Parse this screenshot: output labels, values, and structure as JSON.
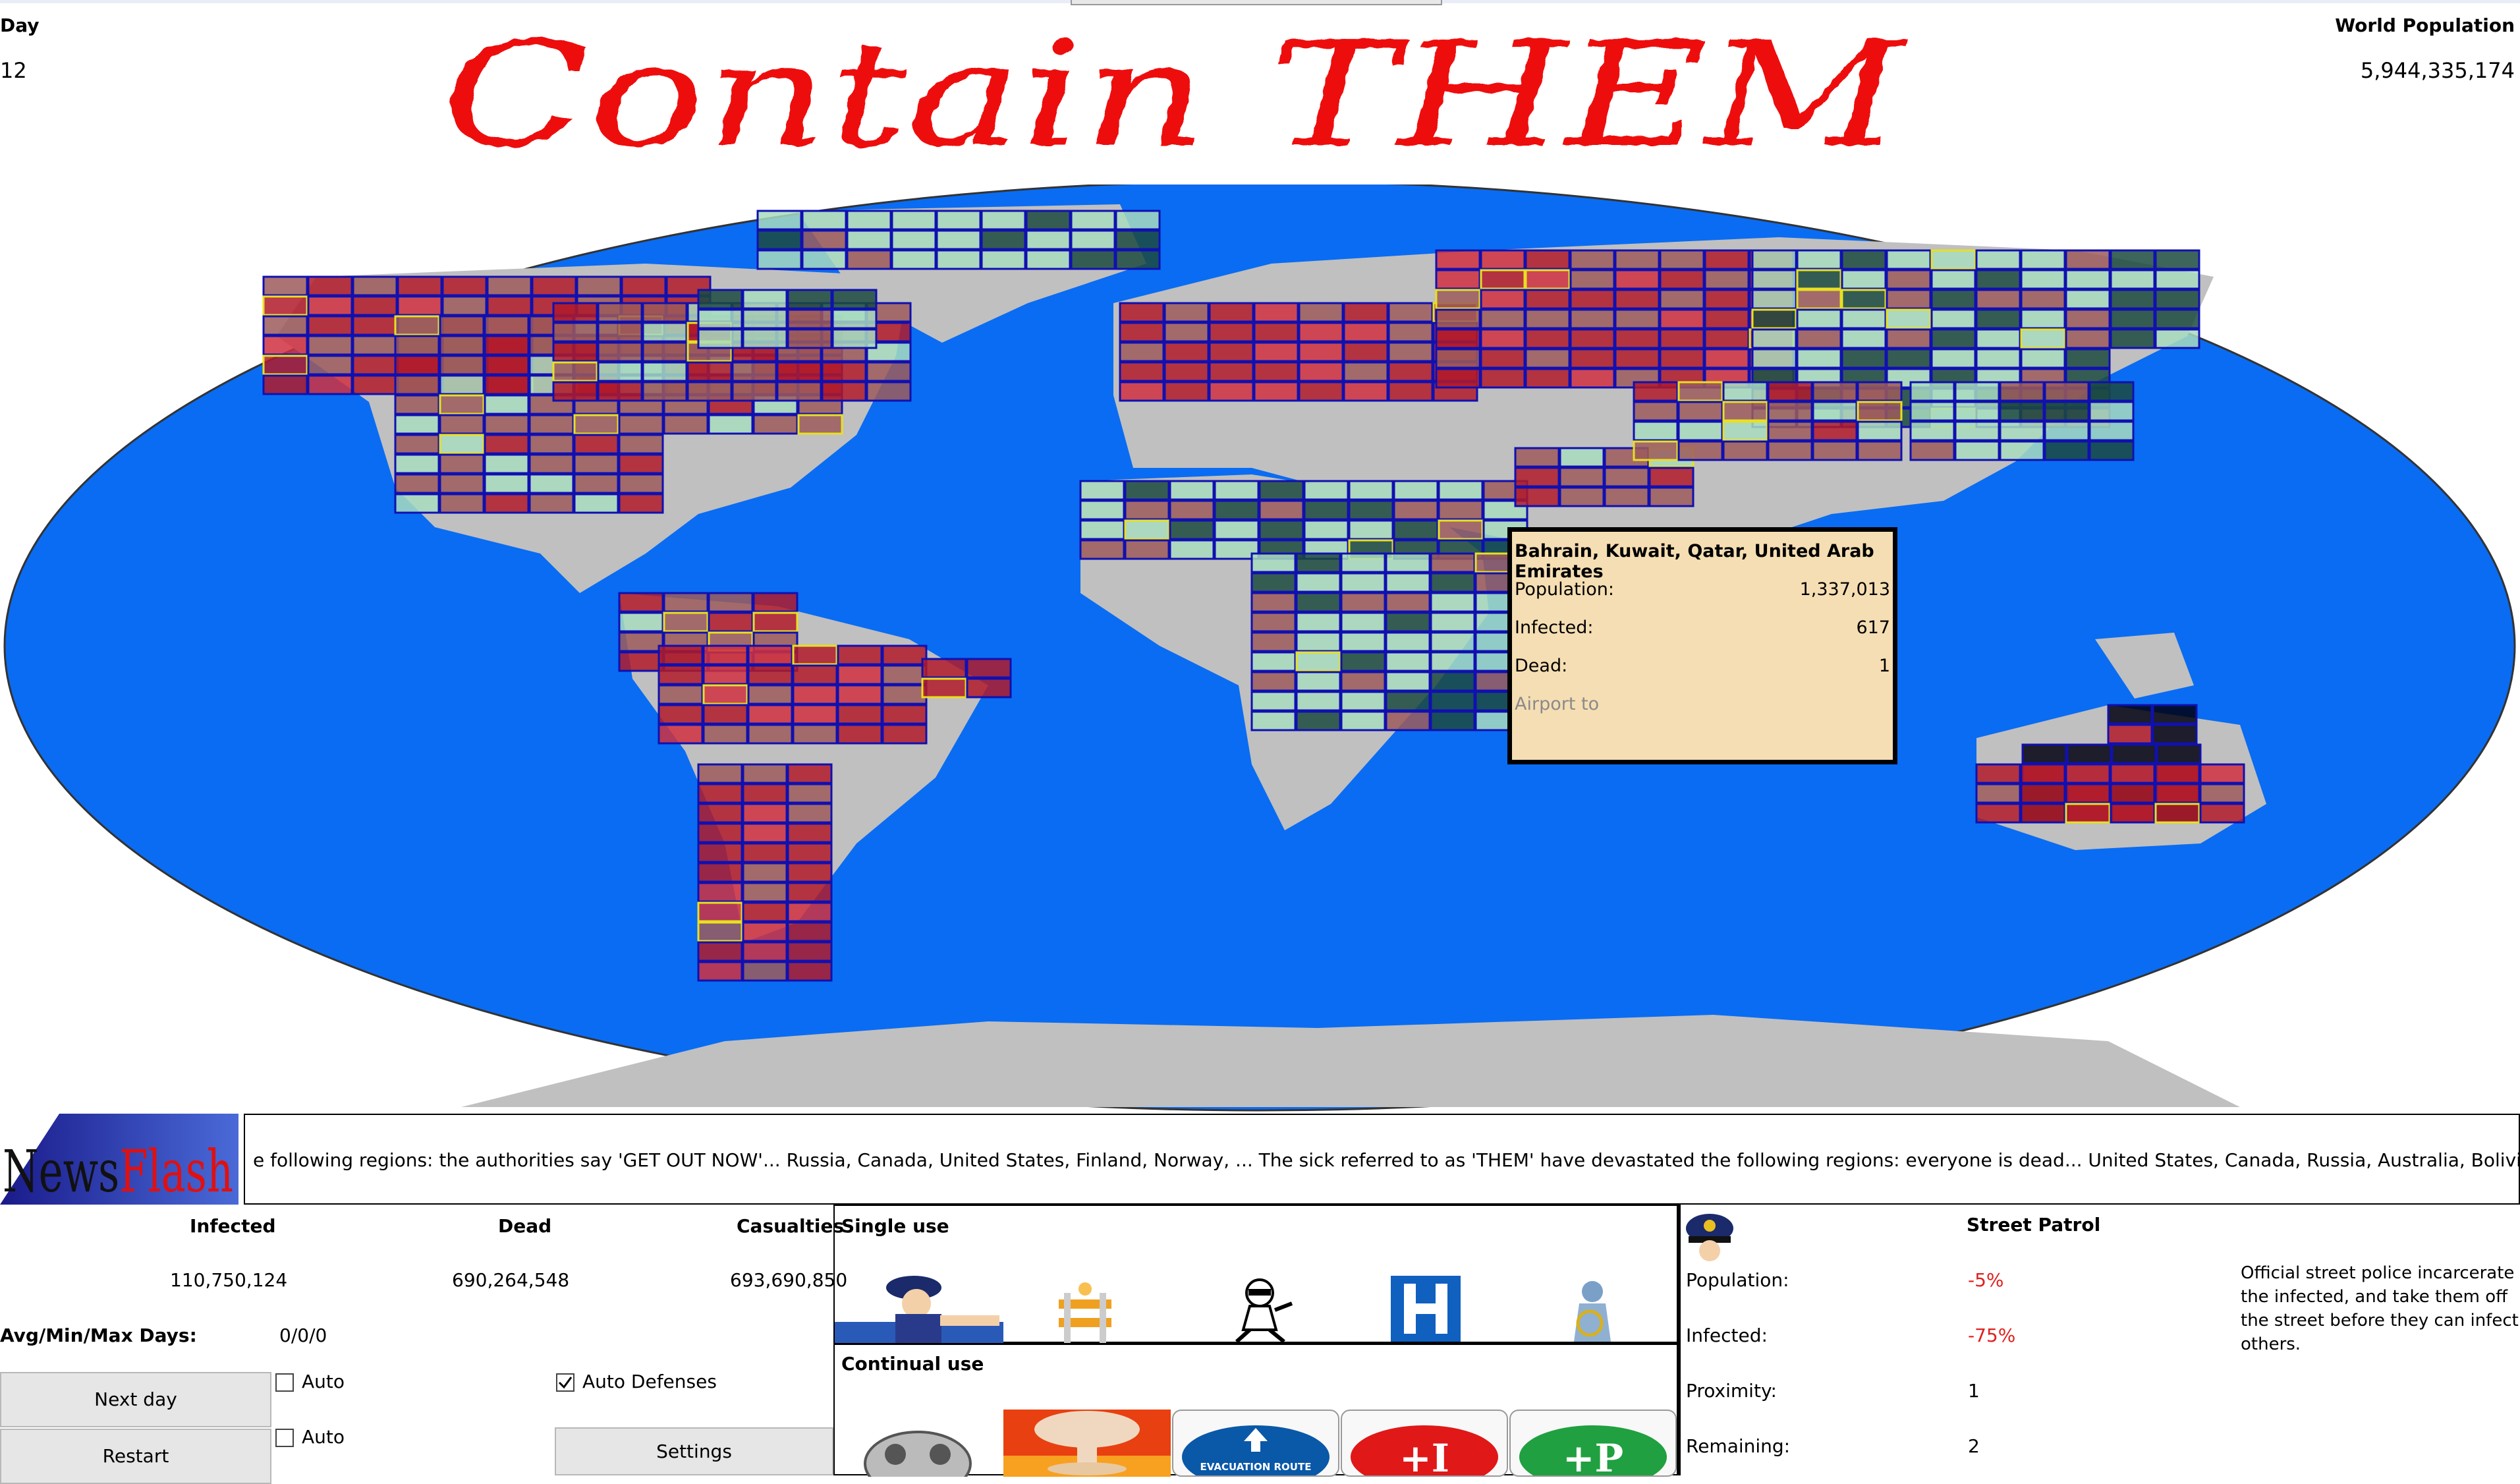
{
  "header": {
    "day_label": "Day",
    "day_value": "12",
    "world_population_label": "World Population",
    "world_population_value": "5,944,335,174",
    "logo_text": "Contain THEM"
  },
  "tooltip": {
    "region": "Bahrain, Kuwait, Qatar, United Arab Emirates",
    "population_label": "Population:",
    "population_value": "1,337,013",
    "infected_label": "Infected:",
    "infected_value": "617",
    "dead_label": "Dead:",
    "dead_value": "1",
    "airport_label": "Airport to"
  },
  "newsflash": {
    "logo_text_news": "News",
    "logo_text_flash": "Flash",
    "ticker": "e following regions: the authorities say 'GET OUT NOW'...  Russia,  Canada,  United States,  Finland,  Norway, ... The sick referred to as 'THEM' have devastated the following regions: everyone is dead...  United States,  Canada,  Russia,  Australia,  Bolivia, ... The infection has spread and is now i"
  },
  "stats": {
    "infected_label": "Infected",
    "infected_value": "110,750,124",
    "dead_label": "Dead",
    "dead_value": "690,264,548",
    "casualties_label": "Casualties",
    "casualties_value": "693,690,850",
    "days_label": "Avg/Min/Max Days:",
    "days_value": "0/0/0"
  },
  "controls": {
    "next_day": "Next day",
    "restart": "Restart",
    "settings": "Settings",
    "auto1": "Auto",
    "auto2": "Auto",
    "auto_defenses": "Auto Defenses",
    "auto_defenses_checked": true
  },
  "single_use": {
    "title": "Single use",
    "items": [
      "police-officer-icon",
      "barricade-icon",
      "burglar-icon",
      "hospital-icon",
      "hazmat-worker-icon"
    ]
  },
  "continual_use": {
    "title": "Continual use",
    "items": [
      "gas-mask-icon",
      "nuke-icon",
      "evacuation-route-icon",
      "plus-i-icon",
      "plus-p-icon"
    ],
    "evacuation_text": "EVACUATION ROUTE",
    "plus_i_text": "+I",
    "plus_p_text": "+P"
  },
  "info": {
    "title": "Street Patrol",
    "population_label": "Population:",
    "population_value": "-5%",
    "infected_label": "Infected:",
    "infected_value": "-75%",
    "proximity_label": "Proximity:",
    "proximity_value": "1",
    "remaining_label": "Remaining:",
    "remaining_value": "2",
    "description": "Official street police incarcerate the infected, and take them off the street before they can infect others.",
    "negative_color": "#e02020"
  },
  "colors": {
    "ocean": "#0a6cf2",
    "land": "#c0c0c0",
    "cell_infected": "#9c5a5a",
    "cell_heavy": "#b01a2a",
    "cell_dead": "#000010",
    "cell_clean": "#a8dcc0",
    "cell_border": "#1010b0",
    "tooltip_bg": "#f5deb3"
  }
}
